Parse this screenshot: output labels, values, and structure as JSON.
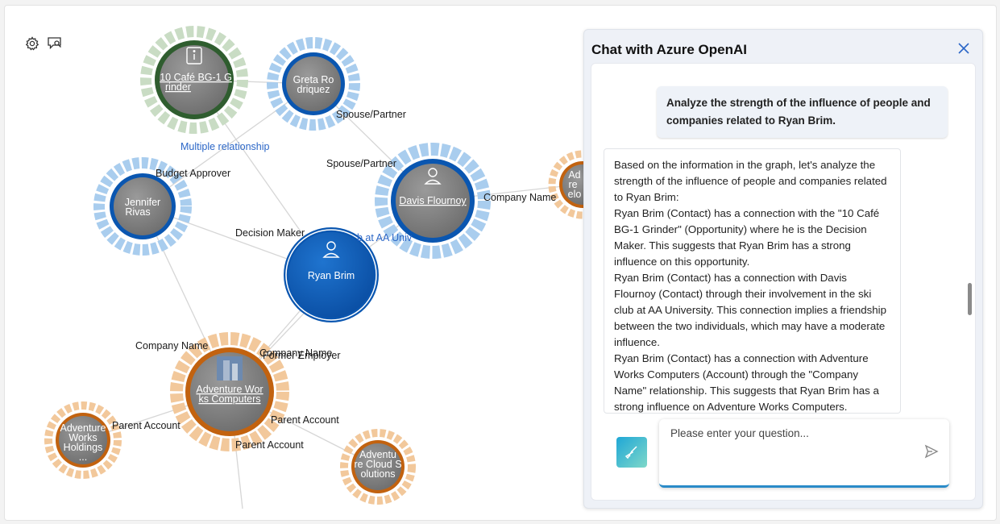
{
  "toolbar": {
    "settings_icon": "gear-icon",
    "chat_icon": "chat-search-icon"
  },
  "graph": {
    "edge_labels": {
      "multiple_relationship": "Multiple relationship",
      "spouse_partner_1": "Spouse/Partner",
      "spouse_partner_2": "Spouse/Partner",
      "budget_approver": "Budget Approver",
      "company_name_1": "Company Name",
      "decision_maker": "Decision Maker",
      "club_partial": "b at AA Univ",
      "company_name_2": "Company Name",
      "company_name_3": "Company Name",
      "former_employer": "Former Employer",
      "parent_account_1": "Parent Account",
      "parent_account_2": "Parent Account",
      "parent_account_3": "Parent Account"
    },
    "nodes": {
      "cafe": {
        "line1": "10 Café BG-1 G",
        "line2": "rinder",
        "icon": "info-icon"
      },
      "greta": {
        "line1": "Greta Ro",
        "line2": "driquez"
      },
      "jennifer": {
        "line1": "Jennifer",
        "line2": "Rivas"
      },
      "davis": {
        "line1": "Davis Flournoy",
        "icon": "person-icon"
      },
      "ryan": {
        "line1": "Ryan Brim",
        "icon": "person-icon"
      },
      "adventure_works": {
        "line1": "Adventure Wor",
        "line2": "ks Computers",
        "icon": "building-image"
      },
      "aw_holdings": {
        "line1": "Adventure",
        "line2": "Works",
        "line3": "Holdings",
        "line4": "..."
      },
      "aw_cloud": {
        "line1": "Adventu",
        "line2": "re Cloud S",
        "line3": "olutions"
      },
      "edge_partial": {
        "line1": "Ad",
        "line2": "re",
        "line3": "elo"
      }
    },
    "colors": {
      "blue_node": "#0a56b0",
      "gray_node": "#7f7f7f",
      "green_ring": "#2f5d2f",
      "orange_ring": "#c2620f",
      "light_blue_ring": "#a9cdee",
      "light_orange_ring": "#f2c89b",
      "light_green_ring": "#c9dcc4"
    }
  },
  "chat": {
    "title": "Chat with Azure OpenAI",
    "close_icon": "close-icon",
    "user_message": "Analyze the strength of the influence of people and companies related to Ryan Brim.",
    "bot_paragraphs": [
      "Based on the information in the graph, let's analyze the strength of the influence of people and companies related to Ryan Brim:",
      "Ryan Brim (Contact) has a connection with the \"10 Café BG-1 Grinder\" (Opportunity) where he is the Decision Maker. This suggests that Ryan Brim has a strong influence on this opportunity.",
      "Ryan Brim (Contact) has a connection with Davis Flournoy (Contact) through their involvement in the ski club at AA University. This connection implies a friendship between the two individuals, which may have a moderate influence.",
      "Ryan Brim (Contact) has a connection with Adventure Works Computers (Account) through the \"Company Name\" relationship. This suggests that Ryan Brim has a strong influence on Adventure Works Computers."
    ],
    "clear_icon": "broom-icon",
    "input": {
      "placeholder": "Please enter your question...",
      "value": ""
    },
    "send_icon": "send-icon"
  }
}
